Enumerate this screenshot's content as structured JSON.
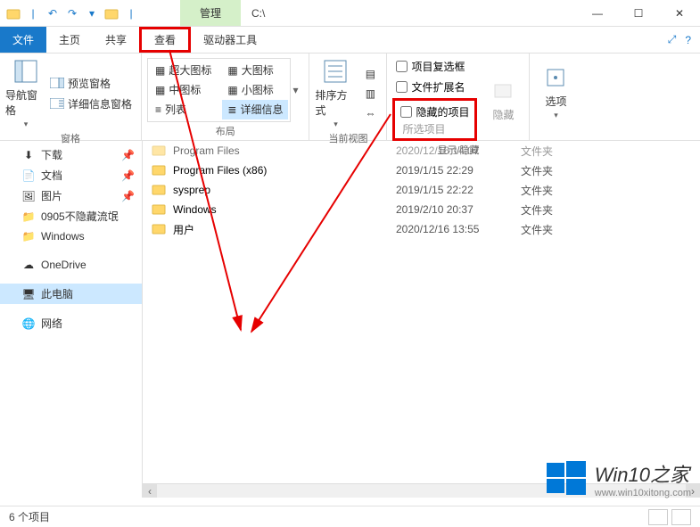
{
  "title_context_tab": "管理",
  "address": "C:\\",
  "ribbon_tabs": {
    "file": "文件",
    "home": "主页",
    "share": "共享",
    "view": "查看",
    "drive_tools": "驱动器工具"
  },
  "ribbon": {
    "panes": {
      "nav_pane": "导航窗格",
      "preview_pane": "预览窗格",
      "details_pane": "详细信息窗格",
      "group_label": "窗格"
    },
    "layout": {
      "extra_large": "超大图标",
      "large": "大图标",
      "medium": "中图标",
      "small": "小图标",
      "list": "列表",
      "details": "详细信息",
      "group_label": "布局"
    },
    "current_view": {
      "sort_by": "排序方式",
      "group_label": "当前视图"
    },
    "show_hide": {
      "item_checkboxes": "项目复选框",
      "file_ext": "文件扩展名",
      "hidden_items": "隐藏的项目",
      "selected_items": "所选项目",
      "hide_button": "隐藏",
      "group_label": "显示/隐藏"
    },
    "options": {
      "options": "选项"
    }
  },
  "sidebar": {
    "items": [
      {
        "label": "下载",
        "icon": "download"
      },
      {
        "label": "文档",
        "icon": "document"
      },
      {
        "label": "图片",
        "icon": "picture"
      },
      {
        "label": "0905不隐藏流氓",
        "icon": "folder"
      },
      {
        "label": "Windows",
        "icon": "folder"
      },
      {
        "label": "OneDrive",
        "icon": "onedrive"
      },
      {
        "label": "此电脑",
        "icon": "pc",
        "selected": true
      },
      {
        "label": "网络",
        "icon": "network"
      }
    ]
  },
  "files": [
    {
      "name": "Program Files",
      "date": "2020/12/16 14:07",
      "type": "文件夹"
    },
    {
      "name": "Program Files (x86)",
      "date": "2019/1/15 22:29",
      "type": "文件夹"
    },
    {
      "name": "sysprep",
      "date": "2019/1/15 22:22",
      "type": "文件夹"
    },
    {
      "name": "Windows",
      "date": "2019/2/10 20:37",
      "type": "文件夹"
    },
    {
      "name": "用户",
      "date": "2020/12/16 13:55",
      "type": "文件夹"
    }
  ],
  "statusbar": {
    "count": "6 个项目"
  },
  "watermark": {
    "title": "Win10之家",
    "url": "www.win10xitong.com"
  }
}
